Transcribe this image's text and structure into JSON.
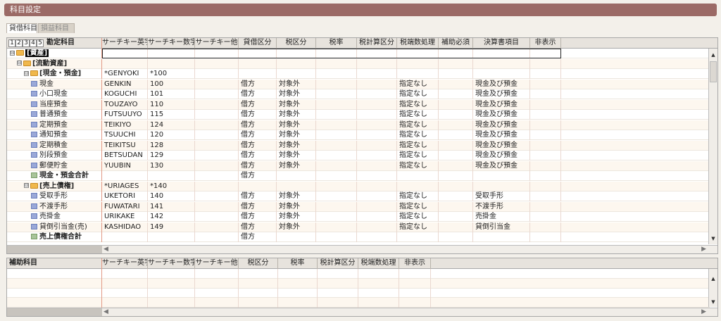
{
  "title": "科目設定",
  "tabs": [
    {
      "label": "貸借科目",
      "active": true
    },
    {
      "label": "損益科目",
      "active": false
    }
  ],
  "level_buttons": [
    "1",
    "2",
    "3",
    "4",
    "5"
  ],
  "grid": {
    "columns": [
      "勘定科目",
      "サーチキー英字",
      "サーチキー数字",
      "サーチキー他",
      "貸借区分",
      "税区分",
      "税率",
      "税計算区分",
      "税端数処理",
      "補助必須",
      "決算書項目",
      "非表示"
    ],
    "rows": [
      {
        "indent": 0,
        "icon": "folder",
        "toggle": "⊟",
        "name": "[資産]",
        "bold": true,
        "selected": true,
        "cells": [
          "",
          "",
          "",
          "",
          "",
          "",
          "",
          "",
          "",
          "",
          ""
        ]
      },
      {
        "indent": 1,
        "icon": "folder",
        "toggle": "⊟",
        "name": "[流動資産]",
        "bold": true,
        "cells": [
          "",
          "",
          "",
          "",
          "",
          "",
          "",
          "",
          "",
          "",
          ""
        ]
      },
      {
        "indent": 2,
        "icon": "folder",
        "toggle": "⊟",
        "name": "[現金・預金]",
        "bold": true,
        "cells": [
          "*GENYOKI",
          "*100",
          "",
          "",
          "",
          "",
          "",
          "",
          "",
          "",
          ""
        ]
      },
      {
        "indent": 3,
        "icon": "doc",
        "name": "現金",
        "cells": [
          "GENKIN",
          "100",
          "",
          "借方",
          "対象外",
          "",
          "",
          "指定なし",
          "",
          "現金及び預金",
          ""
        ]
      },
      {
        "indent": 3,
        "icon": "doc",
        "name": "小口現金",
        "cells": [
          "KOGUCHI",
          "101",
          "",
          "借方",
          "対象外",
          "",
          "",
          "指定なし",
          "",
          "現金及び預金",
          ""
        ]
      },
      {
        "indent": 3,
        "icon": "doc",
        "name": "当座預金",
        "cells": [
          "TOUZAYO",
          "110",
          "",
          "借方",
          "対象外",
          "",
          "",
          "指定なし",
          "",
          "現金及び預金",
          ""
        ]
      },
      {
        "indent": 3,
        "icon": "doc",
        "name": "普通預金",
        "cells": [
          "FUTSUUYO",
          "115",
          "",
          "借方",
          "対象外",
          "",
          "",
          "指定なし",
          "",
          "現金及び預金",
          ""
        ]
      },
      {
        "indent": 3,
        "icon": "doc",
        "name": "定期預金",
        "cells": [
          "TEIKIYO",
          "124",
          "",
          "借方",
          "対象外",
          "",
          "",
          "指定なし",
          "",
          "現金及び預金",
          ""
        ]
      },
      {
        "indent": 3,
        "icon": "doc",
        "name": "通知預金",
        "cells": [
          "TSUUCHI",
          "120",
          "",
          "借方",
          "対象外",
          "",
          "",
          "指定なし",
          "",
          "現金及び預金",
          ""
        ]
      },
      {
        "indent": 3,
        "icon": "doc",
        "name": "定期積金",
        "cells": [
          "TEIKITSU",
          "128",
          "",
          "借方",
          "対象外",
          "",
          "",
          "指定なし",
          "",
          "現金及び預金",
          ""
        ]
      },
      {
        "indent": 3,
        "icon": "doc",
        "name": "別段預金",
        "cells": [
          "BETSUDAN",
          "129",
          "",
          "借方",
          "対象外",
          "",
          "",
          "指定なし",
          "",
          "現金及び預金",
          ""
        ]
      },
      {
        "indent": 3,
        "icon": "doc",
        "name": "郵便貯金",
        "cells": [
          "YUUBIN",
          "130",
          "",
          "借方",
          "対象外",
          "",
          "",
          "指定なし",
          "",
          "現金及び預金",
          ""
        ]
      },
      {
        "indent": 3,
        "icon": "sum",
        "name": "現金・預金合計",
        "bold": true,
        "cells": [
          "",
          "",
          "",
          "借方",
          "",
          "",
          "",
          "",
          "",
          "",
          ""
        ]
      },
      {
        "indent": 2,
        "icon": "folder",
        "toggle": "⊟",
        "name": "[売上債権]",
        "bold": true,
        "cells": [
          "*URIAGES",
          "*140",
          "",
          "",
          "",
          "",
          "",
          "",
          "",
          "",
          ""
        ]
      },
      {
        "indent": 3,
        "icon": "doc",
        "name": "受取手形",
        "cells": [
          "UKETORI",
          "140",
          "",
          "借方",
          "対象外",
          "",
          "",
          "指定なし",
          "",
          "受取手形",
          ""
        ]
      },
      {
        "indent": 3,
        "icon": "doc",
        "name": "不渡手形",
        "cells": [
          "FUWATARI",
          "141",
          "",
          "借方",
          "対象外",
          "",
          "",
          "指定なし",
          "",
          "不渡手形",
          ""
        ]
      },
      {
        "indent": 3,
        "icon": "doc",
        "name": "売掛金",
        "cells": [
          "URIKAKE",
          "142",
          "",
          "借方",
          "対象外",
          "",
          "",
          "指定なし",
          "",
          "売掛金",
          ""
        ]
      },
      {
        "indent": 3,
        "icon": "doc",
        "name": "貸倒引当金(売)",
        "cells": [
          "KASHIDAO",
          "149",
          "",
          "借方",
          "対象外",
          "",
          "",
          "指定なし",
          "",
          "貸倒引当金",
          ""
        ]
      },
      {
        "indent": 3,
        "icon": "sum",
        "name": "売上債権合計",
        "bold": true,
        "cells": [
          "",
          "",
          "",
          "借方",
          "",
          "",
          "",
          "",
          "",
          "",
          ""
        ]
      }
    ]
  },
  "sub_grid": {
    "columns": [
      "補助科目",
      "サーチキー英字",
      "サーチキー数字",
      "サーチキー他",
      "税区分",
      "税率",
      "税計算区分",
      "税端数処理",
      "非表示"
    ]
  },
  "scroll": {
    "up": "▲",
    "down": "▼",
    "left": "◀",
    "right": "▶"
  }
}
